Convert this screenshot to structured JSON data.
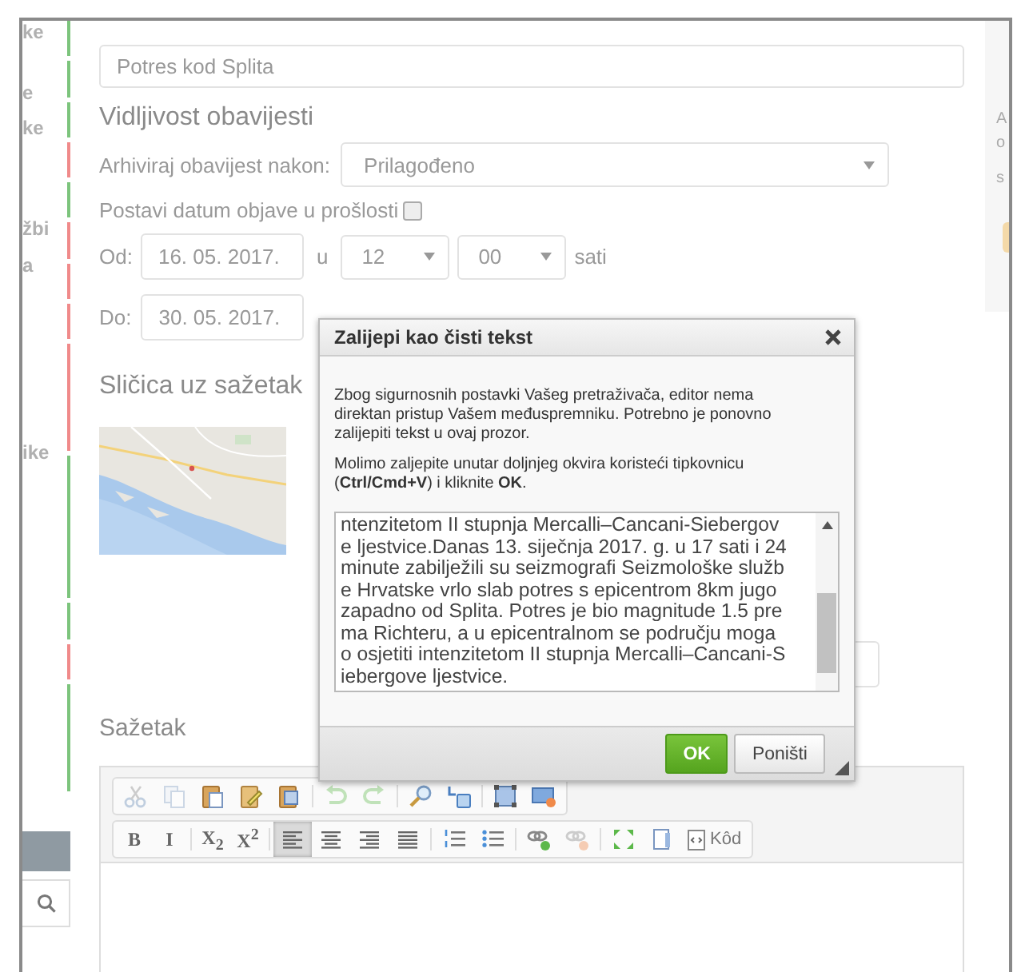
{
  "sidebar": {
    "items": [
      {
        "label": "ke"
      },
      {
        "label": "e"
      },
      {
        "label": "ke"
      },
      {
        "label": "žbi"
      },
      {
        "label": "a"
      },
      {
        "label": "ike"
      }
    ],
    "stripes": [
      {
        "color": "#7cc47c"
      },
      {
        "color": "#7cc47c"
      },
      {
        "color": "#7cc47c"
      },
      {
        "color": "#f08a8a"
      },
      {
        "color": "#7cc47c"
      },
      {
        "color": "#f08a8a"
      },
      {
        "color": "#f08a8a"
      },
      {
        "color": "#f08a8a"
      },
      {
        "color": "#f08a8a"
      },
      {
        "color": "#7cc47c"
      },
      {
        "color": "#7cc47c"
      },
      {
        "color": "#f08a8a"
      },
      {
        "color": "#7cc47c"
      }
    ]
  },
  "title_field": {
    "value": "Potres kod Splita"
  },
  "visibility": {
    "heading": "Vidljivost obavijesti",
    "archive": {
      "label": "Arhiviraj obavijest nakon:",
      "value": "Prilagođeno"
    },
    "backdate": {
      "label": "Postavi datum objave u prošlosti",
      "checked": false
    },
    "from": {
      "label": "Od:",
      "date": "16. 05. 2017.",
      "at": "u",
      "hour": "12",
      "minute": "00",
      "unit": "sati"
    },
    "to": {
      "label": "Do:",
      "date": "30. 05. 2017."
    }
  },
  "thumbnail": {
    "heading": "Sličica uz sažetak"
  },
  "summary": {
    "heading": "Sažetak",
    "toolbar": [
      [
        [
          {
            "kind": "cut",
            "disabled": true,
            "selected": false
          },
          {
            "kind": "copy",
            "disabled": true,
            "selected": false
          },
          {
            "kind": "paste",
            "disabled": false,
            "selected": false
          },
          {
            "kind": "pastetext",
            "disabled": false,
            "selected": false
          },
          {
            "kind": "pasteword",
            "disabled": false,
            "selected": false
          }
        ],
        [
          {
            "kind": "undo",
            "disabled": true,
            "selected": false
          },
          {
            "kind": "redo",
            "disabled": true,
            "selected": false
          }
        ],
        [
          {
            "kind": "find",
            "disabled": false,
            "selected": false
          },
          {
            "kind": "replace",
            "disabled": false,
            "selected": false
          }
        ],
        [
          {
            "kind": "selectall",
            "disabled": false,
            "selected": false
          },
          {
            "kind": "media",
            "disabled": false,
            "selected": false
          }
        ]
      ],
      [
        [
          {
            "kind": "text",
            "label": "B",
            "disabled": false,
            "selected": false
          },
          {
            "kind": "text",
            "label": "I",
            "disabled": false,
            "selected": false
          }
        ],
        [
          {
            "kind": "text",
            "label": "X$_{2}$",
            "disabled": false,
            "selected": false
          },
          {
            "kind": "text",
            "label": "X$^{2}$",
            "disabled": false,
            "selected": false
          }
        ],
        [
          {
            "kind": "alignleft",
            "disabled": false,
            "selected": true
          },
          {
            "kind": "aligncenter",
            "disabled": false,
            "selected": false
          },
          {
            "kind": "alignright",
            "disabled": false,
            "selected": false
          },
          {
            "kind": "justify",
            "disabled": false,
            "selected": false
          }
        ],
        [
          {
            "kind": "numlist",
            "disabled": false,
            "selected": false
          },
          {
            "kind": "bulllist",
            "disabled": false,
            "selected": false
          }
        ],
        [
          {
            "kind": "link",
            "disabled": false,
            "selected": false
          },
          {
            "kind": "unlink",
            "disabled": true,
            "selected": false
          }
        ],
        [
          {
            "kind": "maximize",
            "disabled": false,
            "selected": false
          },
          {
            "kind": "blocks",
            "disabled": false,
            "selected": false
          },
          {
            "kind": "source",
            "label": "Kôd",
            "disabled": false,
            "selected": false
          }
        ]
      ]
    ]
  },
  "right_panel": {
    "letters": [
      "A",
      "o",
      "s"
    ]
  },
  "dialog": {
    "title": "Zalijepi kao čisti tekst",
    "paragraphs": [
      "Zbog sigurnosnih postavki Vašeg pretraživača, editor nema direktan pristup Vašem međuspremniku. Potrebno je ponovno zalijepiti tekst u ovaj prozor.",
      "Molimo zaljepite unutar doljnjeg okvira koristeći tipkovnicu (**Ctrl/Cmd+V**) i kliknite **OK**."
    ],
    "text_lines": [
      "ntenzitetom II stupnja Mercalli–Cancani-Siebergov",
      "e ljestvice.Danas 13. siječnja 2017. g. u 17 sati i 24",
      "minute zabilježili su seizmografi Seizmološke služb",
      "e Hrvatske vrlo slab potres s epicentrom 8km jugo",
      "zapadno od Splita. Potres je bio magnitude 1.5 pre",
      "ma Richteru, a u epicentralnom se području moga",
      "o osjetiti intenzitetom II stupnja Mercalli–Cancani-S",
      "iebergove ljestvice."
    ],
    "buttons": [
      {
        "label": "OK",
        "kind": "primary"
      },
      {
        "label": "Poništi",
        "kind": "secondary"
      }
    ]
  }
}
